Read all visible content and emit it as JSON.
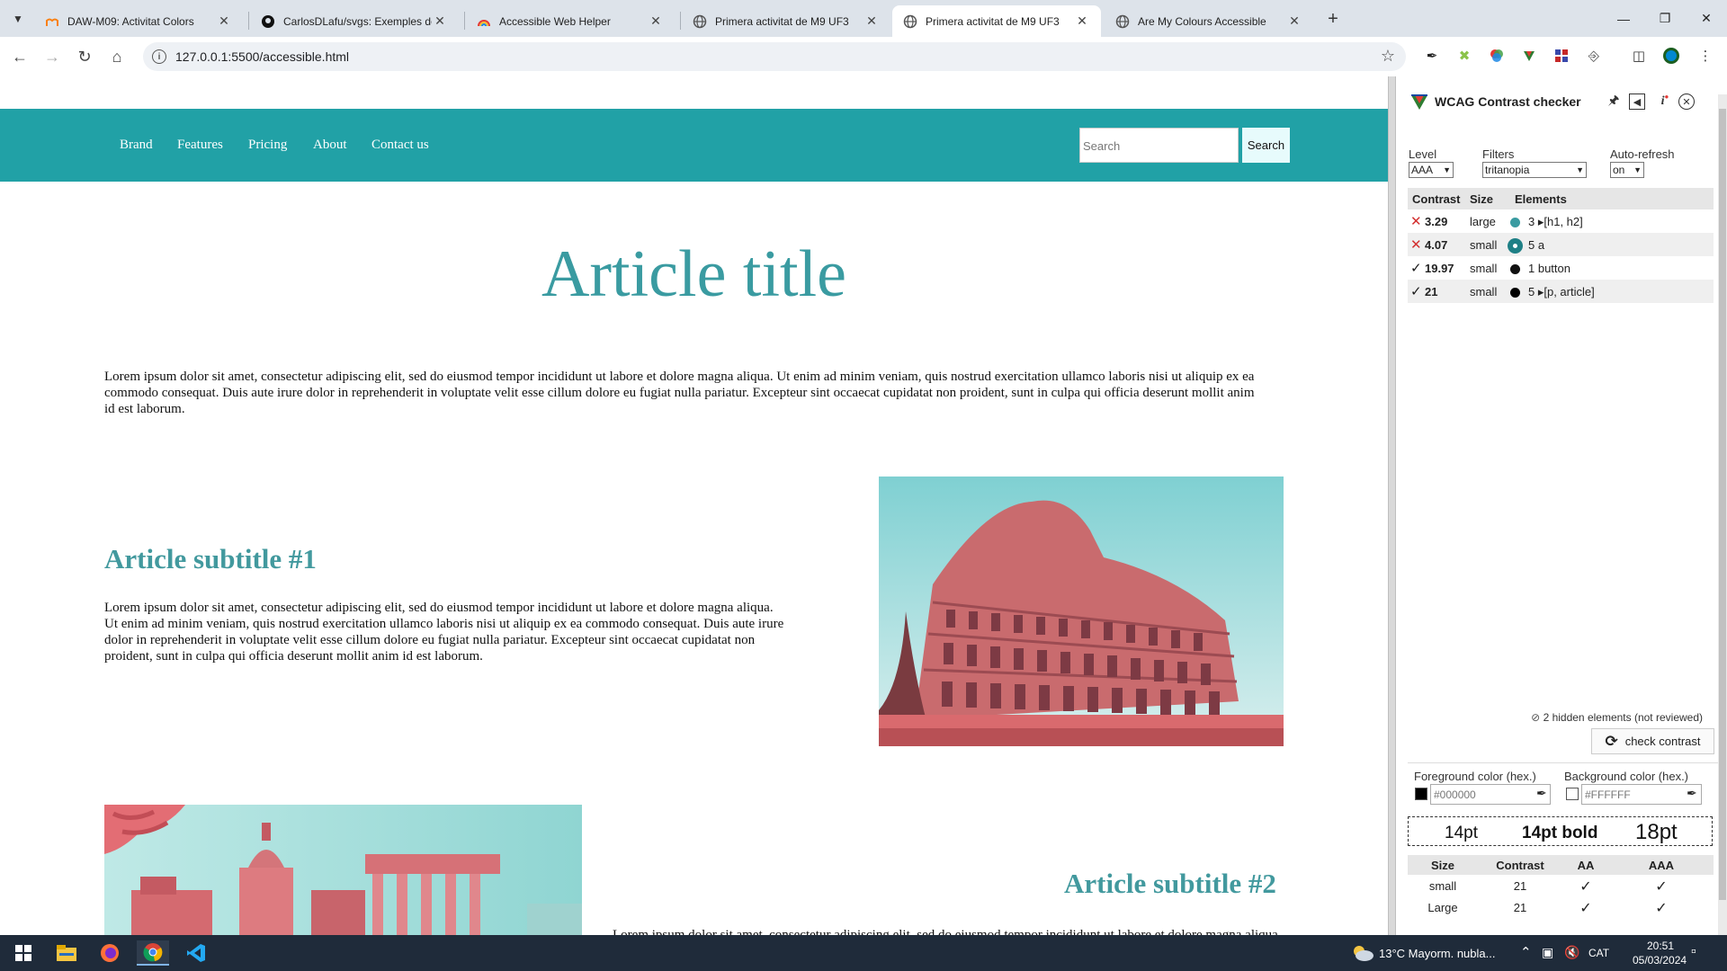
{
  "browser": {
    "tabs": [
      {
        "title": "DAW-M09: Activitat Colors",
        "icon": "moodle-icon"
      },
      {
        "title": "CarlosDLafu/svgs: Exemples de",
        "icon": "github-icon"
      },
      {
        "title": "Accessible Web Helper",
        "icon": "rainbow-icon"
      },
      {
        "title": "Primera activitat de M9 UF3",
        "icon": "globe-icon"
      },
      {
        "title": "Primera activitat de M9 UF3",
        "icon": "globe-icon",
        "active": true
      },
      {
        "title": "Are My Colours Accessible",
        "icon": "globe-icon"
      }
    ],
    "url": "127.0.0.1:5500/accessible.html"
  },
  "site": {
    "nav": [
      "Brand",
      "Features",
      "Pricing",
      "About",
      "Contact us"
    ],
    "search_placeholder": "Search",
    "search_button": "Search",
    "title": "Article title",
    "intro": "Lorem ipsum dolor sit amet, consectetur adipiscing elit, sed do eiusmod tempor incididunt ut labore et dolore magna aliqua. Ut enim ad minim veniam, quis nostrud exercitation ullamco laboris nisi ut aliquip ex ea commodo consequat. Duis aute irure dolor in reprehenderit in voluptate velit esse cillum dolore eu fugiat nulla pariatur. Excepteur sint occaecat cupidatat non proident, sunt in culpa qui officia deserunt mollit anim id est laborum.",
    "subtitle1": "Article subtitle #1",
    "para1": "Lorem ipsum dolor sit amet, consectetur adipiscing elit, sed do eiusmod tempor incididunt ut labore et dolore magna aliqua. Ut enim ad minim veniam, quis nostrud exercitation ullamco laboris nisi ut aliquip ex ea commodo consequat. Duis aute irure dolor in reprehenderit in voluptate velit esse cillum dolore eu fugiat nulla pariatur. Excepteur sint occaecat cupidatat non proident, sunt in culpa qui officia deserunt mollit anim id est laborum.",
    "subtitle2": "Article subtitle #2",
    "para2_fragment": "Lorem ipsum dolor sit amet, consectetur adipiscing elit, sed do eiusmod tempor incididunt ut labore et dolore magna aliqua."
  },
  "wcag": {
    "title": "WCAG Contrast checker",
    "level_label": "Level",
    "level_value": "AAA",
    "filters_label": "Filters",
    "filters_value": "tritanopia",
    "autorefresh_label": "Auto-refresh",
    "autorefresh_value": "on",
    "headers": {
      "contrast": "Contrast",
      "size": "Size",
      "elements": "Elements"
    },
    "results": [
      {
        "pass": false,
        "ratio": "3.29",
        "size": "large",
        "color": "#3a9ba1",
        "elements": "3 ▸[h1, h2]"
      },
      {
        "pass": false,
        "ratio": "4.07",
        "size": "small",
        "color": "#1f8086",
        "elements": "5 a"
      },
      {
        "pass": true,
        "ratio": "19.97",
        "size": "small",
        "color": "#111111",
        "elements": "1 button"
      },
      {
        "pass": true,
        "ratio": "21",
        "size": "small",
        "color": "#000000",
        "elements": "5 ▸[p, article]"
      }
    ],
    "hidden_note": "2 hidden elements (not reviewed)",
    "check_button": "check contrast",
    "fg_label": "Foreground color (hex.)",
    "fg_value": "#000000",
    "bg_label": "Background color (hex.)",
    "bg_value": "#FFFFFF",
    "samples": [
      "14pt",
      "14pt bold",
      "18pt"
    ],
    "size_table": {
      "headers": [
        "Size",
        "Contrast",
        "AA",
        "AAA"
      ],
      "rows": [
        {
          "size": "small",
          "contrast": "21",
          "aa": "✓",
          "aaa": "✓"
        },
        {
          "size": "Large",
          "contrast": "21",
          "aa": "✓",
          "aaa": "✓"
        }
      ]
    }
  },
  "taskbar": {
    "weather": "13°C  Mayorm. nubla...",
    "lang": "CAT",
    "time": "20:51",
    "date": "05/03/2024"
  },
  "colors": {
    "nav_bg": "#21a1a6",
    "heading": "#3a9ba1",
    "fail": "#d32f2f",
    "pass": "#1a1a1a"
  }
}
